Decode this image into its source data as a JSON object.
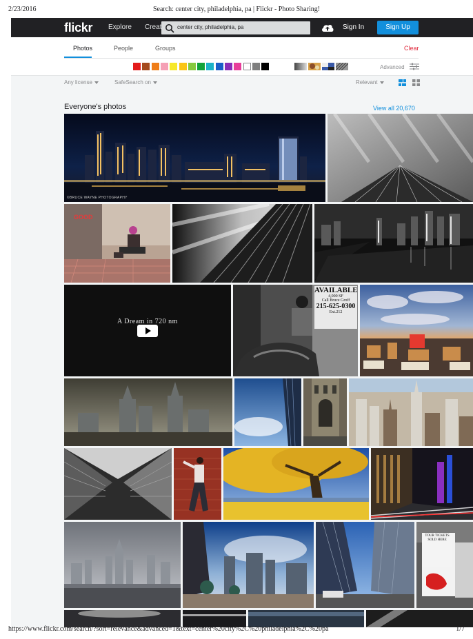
{
  "print": {
    "date": "2/23/2016",
    "title": "Search: center city, philadelphia, pa | Flickr - Photo Sharing!",
    "url": "https://www.flickr.com/search/?sort=relevance&advanced=1&text=center%20city%2C%20philadelphia%2C%20pa",
    "page": "1/7"
  },
  "topbar": {
    "logo": "flickr",
    "nav": [
      "Explore",
      "Creat"
    ],
    "search_value": "center city, philadelphia, pa",
    "signin": "Sign In",
    "signup": "Sign Up"
  },
  "tabs": {
    "items": [
      "Photos",
      "People",
      "Groups"
    ],
    "active": "Photos",
    "clear": "Clear"
  },
  "filters": {
    "colors": [
      "#e31b1b",
      "#a54a1d",
      "#ef7d18",
      "#f5a0b5",
      "#f7e82a",
      "#fac516",
      "#86c93e",
      "#11a33a",
      "#1cb3c8",
      "#1b5ec8",
      "#8a2db8",
      "#e83d9a",
      "#ffffff",
      "#7f7f7f",
      "#000000"
    ],
    "advanced": "Advanced"
  },
  "sortbar": {
    "license": "Any license",
    "safesearch": "SafeSearch on",
    "sort": "Relevant"
  },
  "section": {
    "title": "Everyone's photos",
    "view_all": "View all 20,670"
  },
  "photos": {
    "watermark_1": "©BRUCE WAYNE PHOTOGRAPHY",
    "video_title": "A Dream in 720 nm",
    "sign_lines": [
      "AVAILABLE",
      "4,000 SF",
      "Call Bruce Groff",
      "215-625-0300",
      "Ext.212"
    ],
    "ticket_lines": [
      "TOUR TICKETS",
      "SOLD HERE"
    ]
  }
}
